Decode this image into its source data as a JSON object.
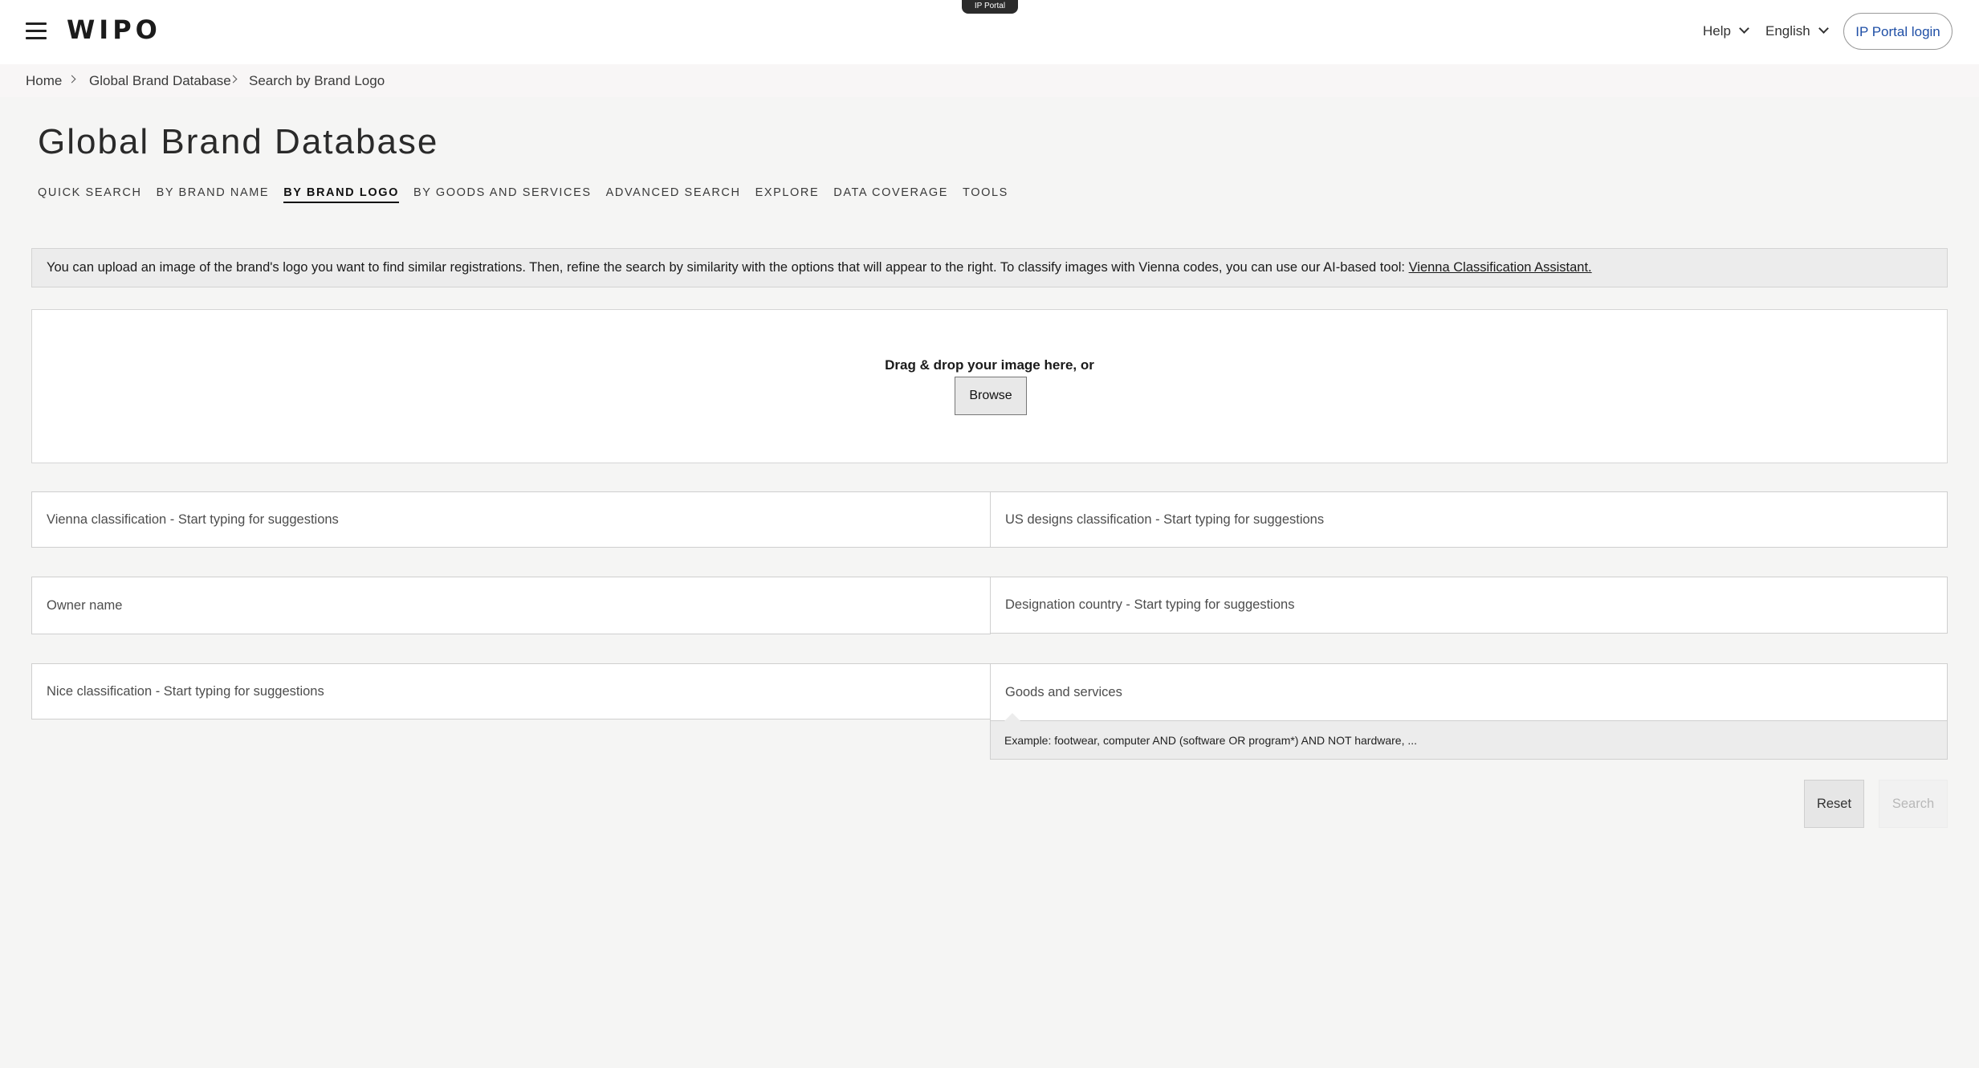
{
  "header": {
    "logo": "WIPO",
    "portal_tab": "IP Portal",
    "help_label": "Help",
    "language_label": "English",
    "login_label": "IP Portal login"
  },
  "breadcrumb": {
    "items": [
      "Home",
      "Global Brand Database",
      "Search by Brand Logo"
    ]
  },
  "page": {
    "title": "Global Brand Database",
    "tabs": [
      {
        "label": "Quick Search",
        "active": false
      },
      {
        "label": "By Brand Name",
        "active": false
      },
      {
        "label": "By Brand Logo",
        "active": true
      },
      {
        "label": "By Goods and Services",
        "active": false
      },
      {
        "label": "Advanced Search",
        "active": false
      },
      {
        "label": "Explore",
        "active": false
      },
      {
        "label": "Data Coverage",
        "active": false
      },
      {
        "label": "Tools",
        "active": false
      }
    ]
  },
  "info": {
    "text": "You can upload an image of the brand's logo you want to find similar registrations. Then, refine the search by similarity with the options that will appear to the right. To classify images with Vienna codes, you can use our AI-based tool: ",
    "link": "Vienna Classification Assistant."
  },
  "dropzone": {
    "label": "Drag & drop your image here, or",
    "browse_label": "Browse"
  },
  "fields": {
    "vienna": "Vienna classification - Start typing for suggestions",
    "us_designs": "US designs classification - Start typing for suggestions",
    "owner": "Owner name",
    "designation_country": "Designation country - Start typing for suggestions",
    "nice": "Nice classification - Start typing for suggestions",
    "goods_services": "Goods and services",
    "goods_hint": "Example: footwear, computer AND (software OR program*) AND NOT hardware, ..."
  },
  "actions": {
    "reset_label": "Reset",
    "search_label": "Search"
  },
  "colors": {
    "accent_link": "#1f4fa6",
    "background": "#f5f5f4"
  }
}
